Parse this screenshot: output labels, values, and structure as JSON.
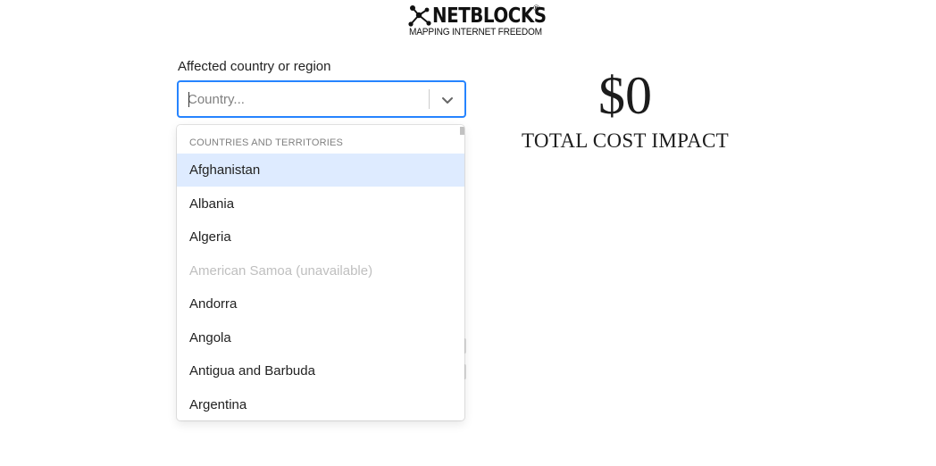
{
  "brand": {
    "name": "NETBLOCKS",
    "registered_mark": "®",
    "tagline": "MAPPING INTERNET FREEDOM"
  },
  "form": {
    "country_label": "Affected country or region",
    "country_placeholder": "Country...",
    "country_value": "",
    "dropdown_icon": "chevron-down-icon",
    "focus_color": "#2684ff"
  },
  "dropdown": {
    "group_heading": "Countries and territories",
    "highlight_color": "#deebff",
    "options": [
      {
        "label": "Afghanistan",
        "state": "focused"
      },
      {
        "label": "Albania",
        "state": "normal"
      },
      {
        "label": "Algeria",
        "state": "normal"
      },
      {
        "label": "American Samoa (unavailable)",
        "state": "disabled"
      },
      {
        "label": "Andorra",
        "state": "normal"
      },
      {
        "label": "Angola",
        "state": "normal"
      },
      {
        "label": "Antigua and Barbuda",
        "state": "normal"
      },
      {
        "label": "Argentina",
        "state": "normal"
      }
    ]
  },
  "result": {
    "cost_value": "$0",
    "cost_label": "TOTAL COST IMPACT"
  }
}
